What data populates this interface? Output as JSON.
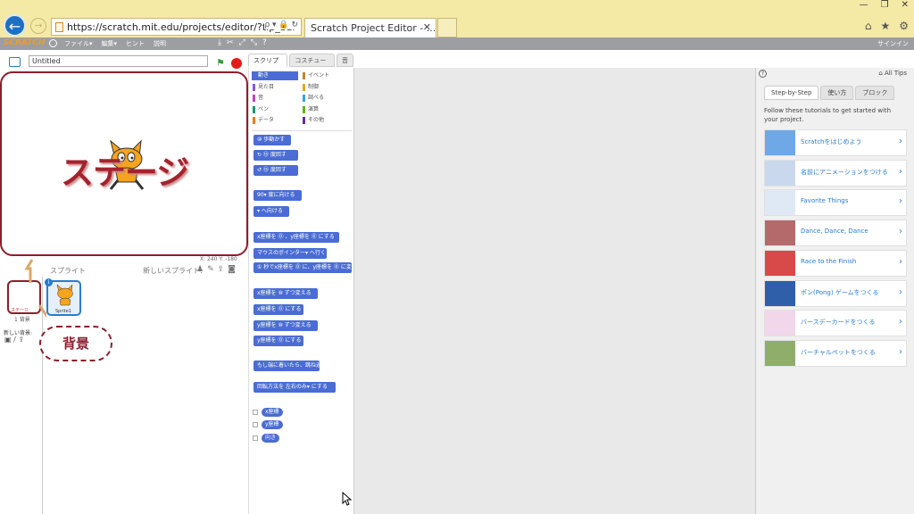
{
  "browser": {
    "url": "https://scratch.mit.edu/projects/editor/?tip_bar",
    "url_tail": "ρ ▾ 🔒 ↻",
    "tab_title": "Scratch Project Editor - ...",
    "tab_close": "✕",
    "window_controls": [
      "—",
      "❐",
      "✕"
    ],
    "right_icons": [
      "⌂",
      "★",
      "⚙"
    ]
  },
  "menubar": {
    "logo": "SCRATCH",
    "menus": [
      "ファイル▾",
      "編集▾",
      "ヒント",
      "説明"
    ],
    "signin": "サインイン"
  },
  "stage": {
    "title_value": "Untitled",
    "overlay_text": "ステージ",
    "coords": "X: 240  Y: -180"
  },
  "sprites": {
    "header": "スプライト",
    "new_sprite": "新しいスプライト:",
    "bg_thumb_label": "ステージ",
    "bg_caption": "1 背景",
    "new_bg": "新しい背景:",
    "sprite_name": "Sprite1",
    "callout": "背景"
  },
  "palette": {
    "tabs": [
      "スクリプト",
      "コスチューム",
      "音"
    ],
    "categories_left": [
      {
        "label": "動き",
        "color": "#4a6cd4"
      },
      {
        "label": "見た目",
        "color": "#8a55d7"
      },
      {
        "label": "音",
        "color": "#bb42c3"
      },
      {
        "label": "ペン",
        "color": "#0e9a6c"
      },
      {
        "label": "データ",
        "color": "#ee7d16"
      }
    ],
    "categories_right": [
      {
        "label": "イベント",
        "color": "#c88330"
      },
      {
        "label": "制御",
        "color": "#e1a91a"
      },
      {
        "label": "調べる",
        "color": "#2ca5e2"
      },
      {
        "label": "演算",
        "color": "#5cb712"
      },
      {
        "label": "その他",
        "color": "#632d99"
      }
    ],
    "blocks": [
      "⑩ 歩動かす",
      "↻ ⑮ 度回す",
      "↺ ⑮ 度回す",
      "90▾ 度に向ける",
      "▾ へ向ける",
      "x座標を ⓪ 、y座標を ⓪ にする",
      "マウスのポインター▾ へ行く",
      "① 秒でx座標を ⓪ に、y座標を ⓪ に変",
      "x座標を ⑩ ずつ変える",
      "x座標を ⓪ にする",
      "y座標を ⑩ ずつ変える",
      "y座標を ⓪ にする",
      "もし端に着いたら、跳ね返る",
      "回転方法を 左右のみ▾ にする"
    ],
    "reporters": [
      "x座標",
      "y座標",
      "向き"
    ]
  },
  "tips": {
    "help": "?",
    "all_tips": "⌂ All Tips",
    "tabs": [
      "Step-by-Step",
      "使い方",
      "ブロック"
    ],
    "intro": "Follow these tutorials to get started with your project.",
    "tutorials": [
      "Scratchをはじめよう",
      "名前にアニメーションをつける",
      "Favorite Things",
      "Dance, Dance, Dance",
      "Race to the Finish",
      "ポン(Pong) ゲームをつくる",
      "バースデーカードをつくる",
      "バーチャルペットをつくる"
    ]
  }
}
